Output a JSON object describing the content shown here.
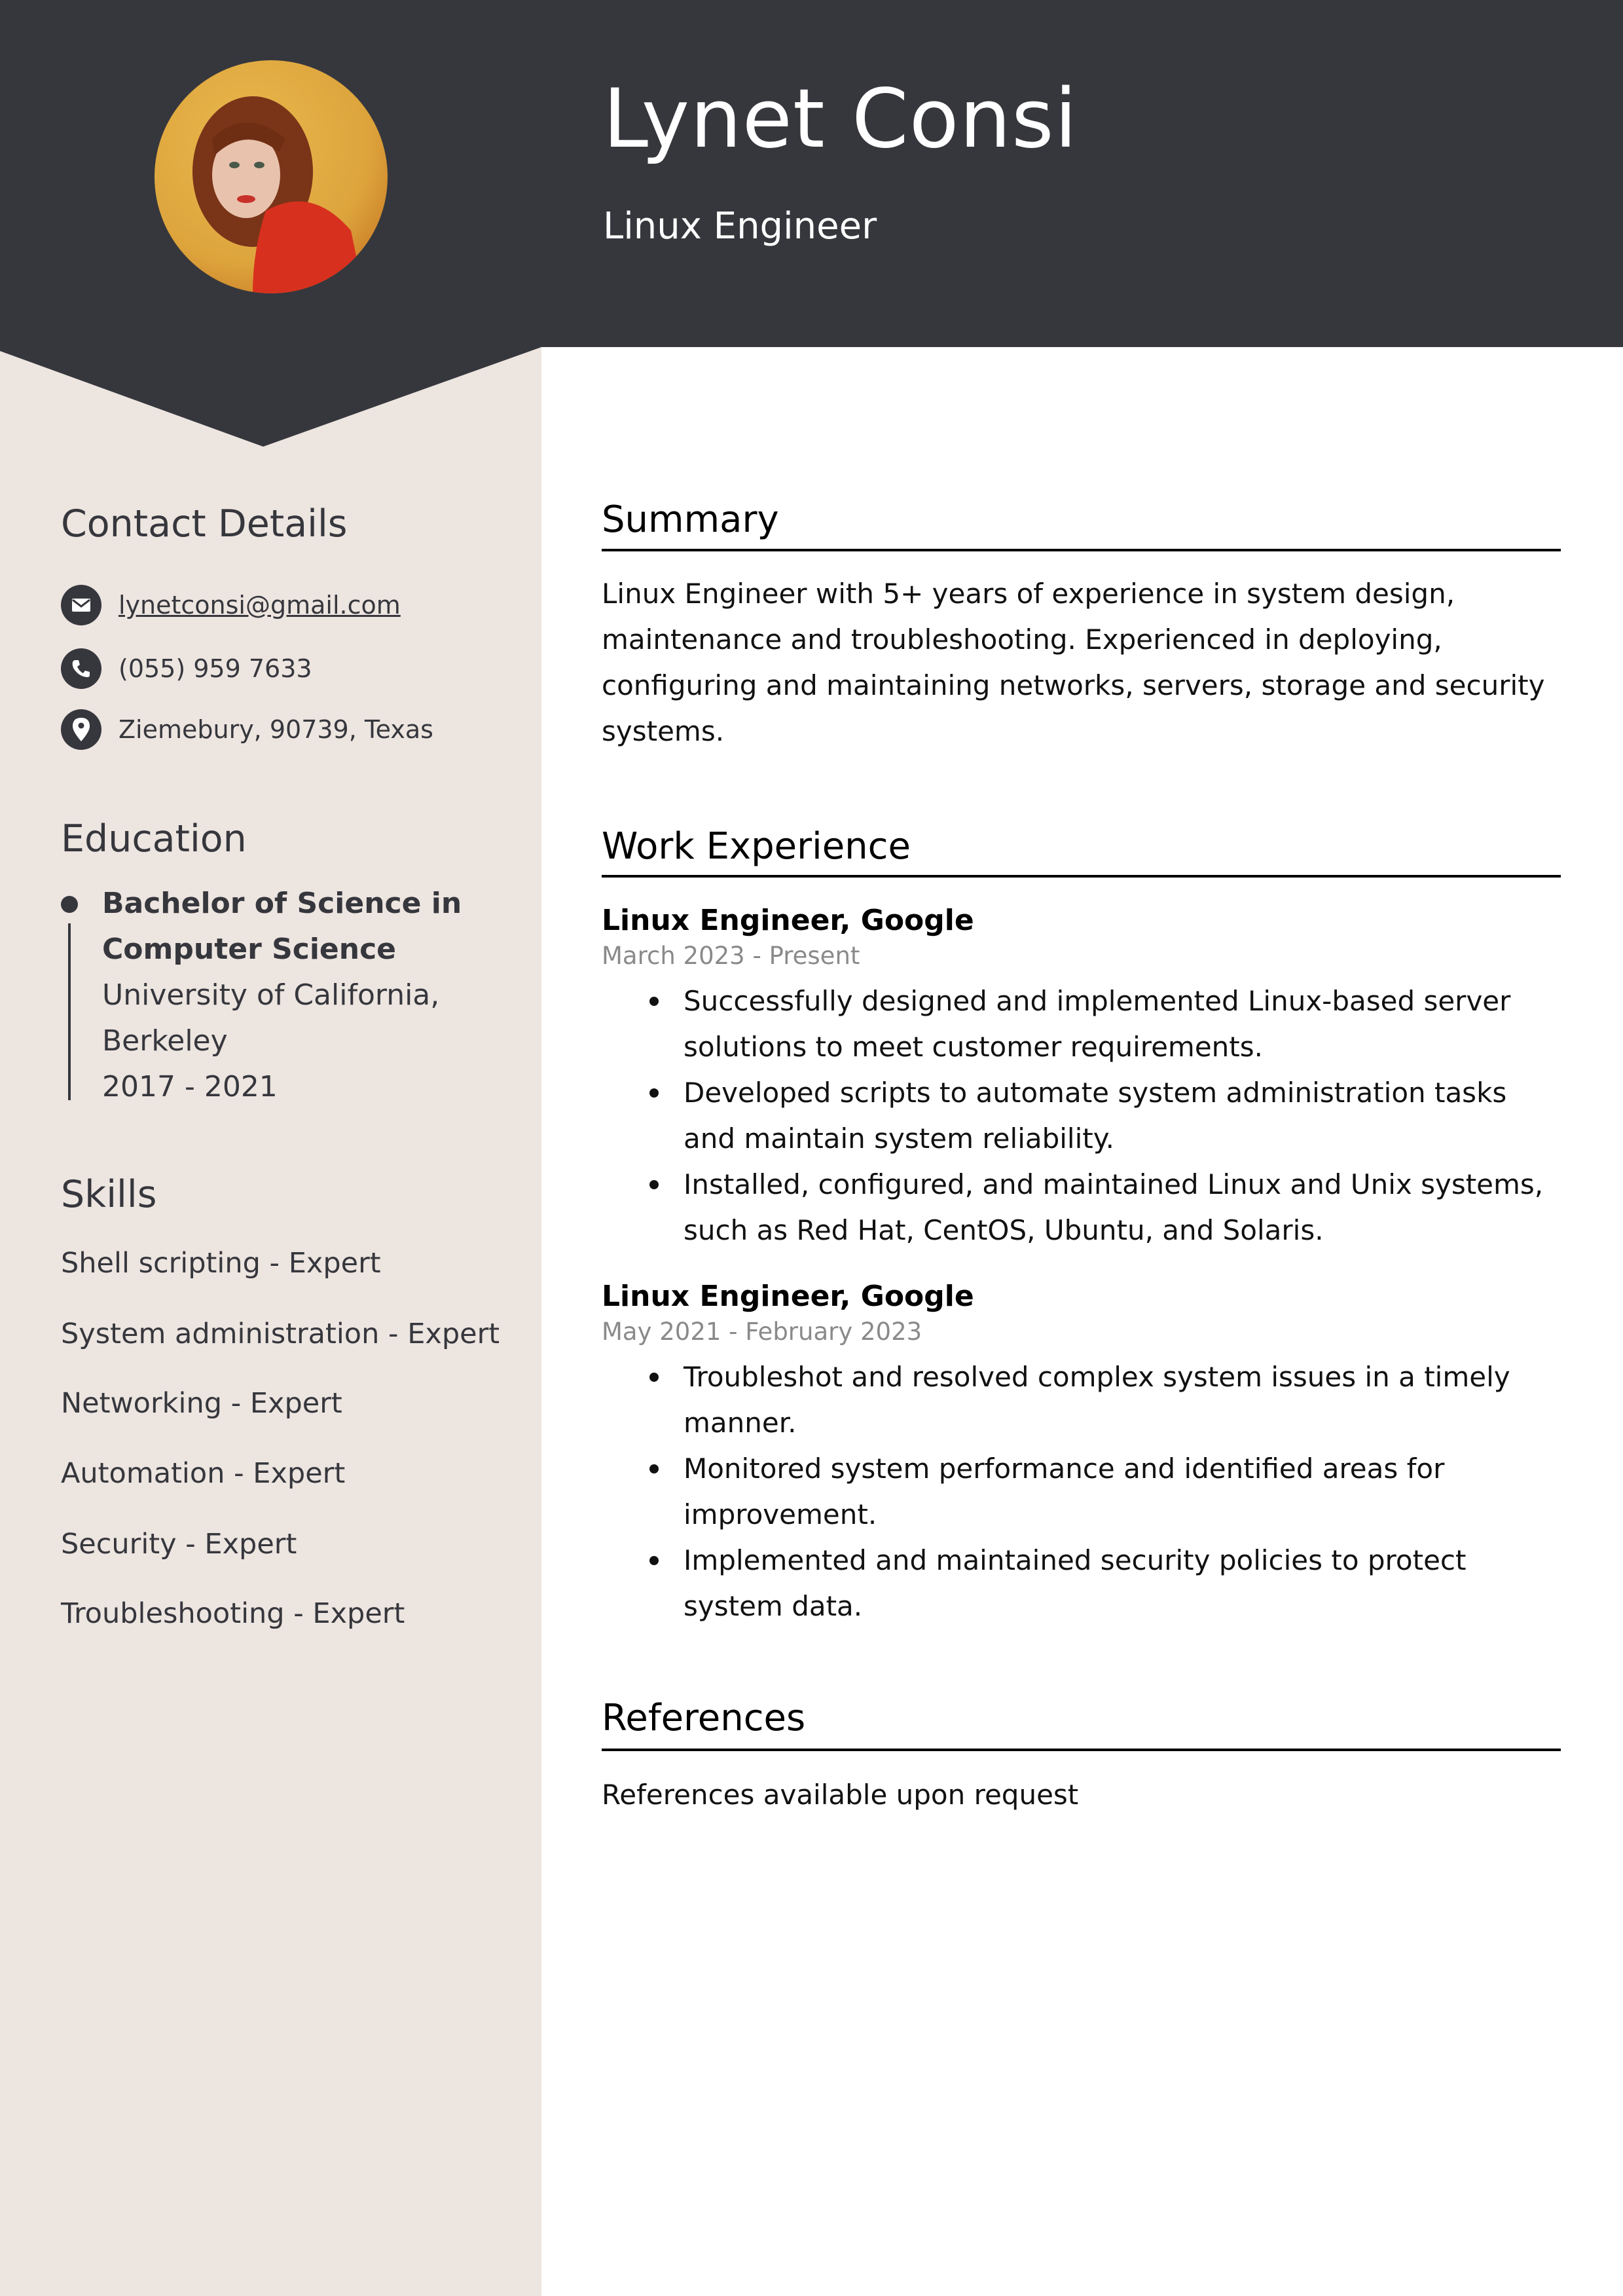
{
  "colors": {
    "header_dark": "#36373d",
    "sidebar_bg": "#ede5e0",
    "text_dark": "#36373d",
    "date_gray": "#8a8a8a"
  },
  "header": {
    "name": "Lynet Consi",
    "title": "Linux Engineer",
    "photo_alt": "profile-photo"
  },
  "sidebar": {
    "contact": {
      "heading": "Contact Details",
      "items": [
        {
          "icon": "envelope-icon",
          "text": "lynetconsi@gmail.com"
        },
        {
          "icon": "phone-icon",
          "text": "(055) 959 7633"
        },
        {
          "icon": "location-pin-icon",
          "text": "Ziemebury, 90739, Texas"
        }
      ]
    },
    "education": {
      "heading": "Education",
      "degree_line1": "Bachelor of Science in",
      "degree_line2": "Computer Science",
      "school_line1": "University of California,",
      "school_line2": "Berkeley",
      "years": "2017 - 2021"
    },
    "skills": {
      "heading": "Skills",
      "items": [
        "Shell scripting - Expert",
        "System administration - Expert",
        "Networking - Expert",
        "Automation - Expert",
        "Security - Expert",
        "Troubleshooting - Expert"
      ]
    }
  },
  "main": {
    "summary": {
      "heading": "Summary",
      "text": "Linux Engineer with 5+ years of experience in system design, maintenance and troubleshooting. Experienced in deploying, configuring and maintaining networks, servers, storage and security systems."
    },
    "work": {
      "heading": "Work Experience",
      "jobs": [
        {
          "title": "Linux Engineer, Google",
          "dates": "March 2023 - Present",
          "bullets": [
            "Successfully designed and implemented Linux-based server solutions to meet customer requirements.",
            "Developed scripts to automate system administration tasks and maintain system reliability.",
            "Installed, configured, and maintained Linux and Unix systems, such as Red Hat, CentOS, Ubuntu, and Solaris."
          ]
        },
        {
          "title": "Linux Engineer, Google",
          "dates": "May 2021 - February 2023",
          "bullets": [
            "Troubleshot and resolved complex system issues in a timely manner.",
            "Monitored system performance and identified areas for improvement.",
            "Implemented and maintained security policies to protect system data."
          ]
        }
      ]
    },
    "references": {
      "heading": "References",
      "text": "References available upon request"
    }
  }
}
